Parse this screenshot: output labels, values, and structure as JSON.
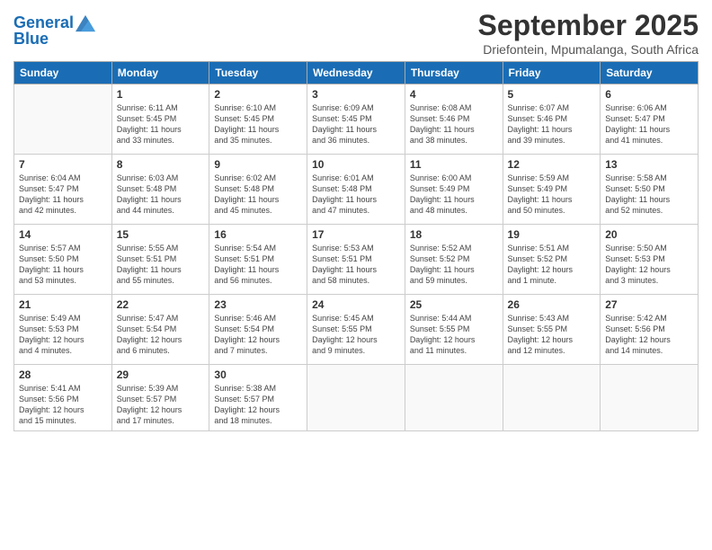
{
  "header": {
    "logo_line1": "General",
    "logo_line2": "Blue",
    "month": "September 2025",
    "location": "Driefontein, Mpumalanga, South Africa"
  },
  "weekdays": [
    "Sunday",
    "Monday",
    "Tuesday",
    "Wednesday",
    "Thursday",
    "Friday",
    "Saturday"
  ],
  "weeks": [
    [
      {
        "day": "",
        "text": ""
      },
      {
        "day": "1",
        "text": "Sunrise: 6:11 AM\nSunset: 5:45 PM\nDaylight: 11 hours\nand 33 minutes."
      },
      {
        "day": "2",
        "text": "Sunrise: 6:10 AM\nSunset: 5:45 PM\nDaylight: 11 hours\nand 35 minutes."
      },
      {
        "day": "3",
        "text": "Sunrise: 6:09 AM\nSunset: 5:45 PM\nDaylight: 11 hours\nand 36 minutes."
      },
      {
        "day": "4",
        "text": "Sunrise: 6:08 AM\nSunset: 5:46 PM\nDaylight: 11 hours\nand 38 minutes."
      },
      {
        "day": "5",
        "text": "Sunrise: 6:07 AM\nSunset: 5:46 PM\nDaylight: 11 hours\nand 39 minutes."
      },
      {
        "day": "6",
        "text": "Sunrise: 6:06 AM\nSunset: 5:47 PM\nDaylight: 11 hours\nand 41 minutes."
      }
    ],
    [
      {
        "day": "7",
        "text": "Sunrise: 6:04 AM\nSunset: 5:47 PM\nDaylight: 11 hours\nand 42 minutes."
      },
      {
        "day": "8",
        "text": "Sunrise: 6:03 AM\nSunset: 5:48 PM\nDaylight: 11 hours\nand 44 minutes."
      },
      {
        "day": "9",
        "text": "Sunrise: 6:02 AM\nSunset: 5:48 PM\nDaylight: 11 hours\nand 45 minutes."
      },
      {
        "day": "10",
        "text": "Sunrise: 6:01 AM\nSunset: 5:48 PM\nDaylight: 11 hours\nand 47 minutes."
      },
      {
        "day": "11",
        "text": "Sunrise: 6:00 AM\nSunset: 5:49 PM\nDaylight: 11 hours\nand 48 minutes."
      },
      {
        "day": "12",
        "text": "Sunrise: 5:59 AM\nSunset: 5:49 PM\nDaylight: 11 hours\nand 50 minutes."
      },
      {
        "day": "13",
        "text": "Sunrise: 5:58 AM\nSunset: 5:50 PM\nDaylight: 11 hours\nand 52 minutes."
      }
    ],
    [
      {
        "day": "14",
        "text": "Sunrise: 5:57 AM\nSunset: 5:50 PM\nDaylight: 11 hours\nand 53 minutes."
      },
      {
        "day": "15",
        "text": "Sunrise: 5:55 AM\nSunset: 5:51 PM\nDaylight: 11 hours\nand 55 minutes."
      },
      {
        "day": "16",
        "text": "Sunrise: 5:54 AM\nSunset: 5:51 PM\nDaylight: 11 hours\nand 56 minutes."
      },
      {
        "day": "17",
        "text": "Sunrise: 5:53 AM\nSunset: 5:51 PM\nDaylight: 11 hours\nand 58 minutes."
      },
      {
        "day": "18",
        "text": "Sunrise: 5:52 AM\nSunset: 5:52 PM\nDaylight: 11 hours\nand 59 minutes."
      },
      {
        "day": "19",
        "text": "Sunrise: 5:51 AM\nSunset: 5:52 PM\nDaylight: 12 hours\nand 1 minute."
      },
      {
        "day": "20",
        "text": "Sunrise: 5:50 AM\nSunset: 5:53 PM\nDaylight: 12 hours\nand 3 minutes."
      }
    ],
    [
      {
        "day": "21",
        "text": "Sunrise: 5:49 AM\nSunset: 5:53 PM\nDaylight: 12 hours\nand 4 minutes."
      },
      {
        "day": "22",
        "text": "Sunrise: 5:47 AM\nSunset: 5:54 PM\nDaylight: 12 hours\nand 6 minutes."
      },
      {
        "day": "23",
        "text": "Sunrise: 5:46 AM\nSunset: 5:54 PM\nDaylight: 12 hours\nand 7 minutes."
      },
      {
        "day": "24",
        "text": "Sunrise: 5:45 AM\nSunset: 5:55 PM\nDaylight: 12 hours\nand 9 minutes."
      },
      {
        "day": "25",
        "text": "Sunrise: 5:44 AM\nSunset: 5:55 PM\nDaylight: 12 hours\nand 11 minutes."
      },
      {
        "day": "26",
        "text": "Sunrise: 5:43 AM\nSunset: 5:55 PM\nDaylight: 12 hours\nand 12 minutes."
      },
      {
        "day": "27",
        "text": "Sunrise: 5:42 AM\nSunset: 5:56 PM\nDaylight: 12 hours\nand 14 minutes."
      }
    ],
    [
      {
        "day": "28",
        "text": "Sunrise: 5:41 AM\nSunset: 5:56 PM\nDaylight: 12 hours\nand 15 minutes."
      },
      {
        "day": "29",
        "text": "Sunrise: 5:39 AM\nSunset: 5:57 PM\nDaylight: 12 hours\nand 17 minutes."
      },
      {
        "day": "30",
        "text": "Sunrise: 5:38 AM\nSunset: 5:57 PM\nDaylight: 12 hours\nand 18 minutes."
      },
      {
        "day": "",
        "text": ""
      },
      {
        "day": "",
        "text": ""
      },
      {
        "day": "",
        "text": ""
      },
      {
        "day": "",
        "text": ""
      }
    ]
  ]
}
